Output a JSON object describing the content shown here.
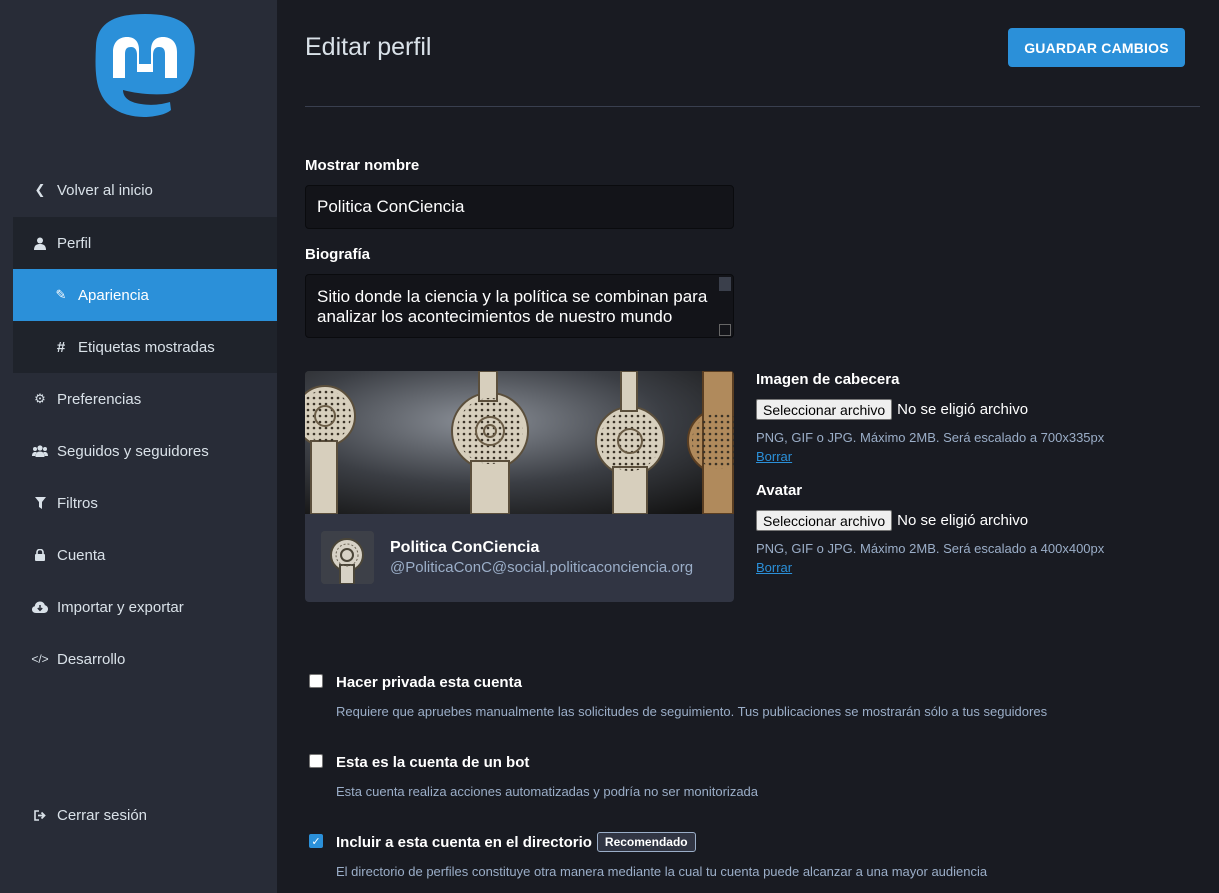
{
  "sidebar": {
    "back": "Volver al inicio",
    "items": [
      {
        "label": "Perfil",
        "icon": "user-icon"
      },
      {
        "label": "Apariencia",
        "icon": "pencil-icon"
      },
      {
        "label": "Etiquetas mostradas",
        "icon": "hashtag-icon"
      },
      {
        "label": "Preferencias",
        "icon": "gear-icon"
      },
      {
        "label": "Seguidos y seguidores",
        "icon": "users-icon"
      },
      {
        "label": "Filtros",
        "icon": "filter-icon"
      },
      {
        "label": "Cuenta",
        "icon": "lock-icon"
      },
      {
        "label": "Importar y exportar",
        "icon": "cloud-download-icon"
      },
      {
        "label": "Desarrollo",
        "icon": "code-icon"
      }
    ],
    "logout": "Cerrar sesión"
  },
  "header": {
    "title": "Editar perfil",
    "save_label": "GUARDAR CAMBIOS"
  },
  "form": {
    "display_name_label": "Mostrar nombre",
    "display_name_value": "Politica ConCiencia",
    "bio_label": "Biografía",
    "bio_value": "Sitio donde la ciencia y la política se combinan para analizar los acontecimientos de nuestro mundo"
  },
  "preview": {
    "name": "Politica ConCiencia",
    "handle": "@PoliticaConC@social.politicaconciencia.org"
  },
  "header_image": {
    "label": "Imagen de cabecera",
    "button": "Seleccionar archivo",
    "status": "No se eligió archivo",
    "hint": "PNG, GIF o JPG. Máximo 2MB. Será escalado a 700x335px",
    "delete": "Borrar"
  },
  "avatar_field": {
    "label": "Avatar",
    "button": "Seleccionar archivo",
    "status": "No se eligió archivo",
    "hint": "PNG, GIF o JPG. Máximo 2MB. Será escalado a 400x400px",
    "delete": "Borrar"
  },
  "options": [
    {
      "label": "Hacer privada esta cuenta",
      "hint": "Requiere que apruebes manualmente las solicitudes de seguimiento. Tus publicaciones se mostrarán sólo a tus seguidores",
      "checked": false
    },
    {
      "label": "Esta es la cuenta de un bot",
      "hint": "Esta cuenta realiza acciones automatizadas y podría no ser monitorizada",
      "checked": false
    },
    {
      "label": "Incluir a esta cuenta en el directorio",
      "badge": "Recomendado",
      "hint": "El directorio de perfiles constituye otra manera mediante la cual tu cuenta puede alcanzar a una mayor audiencia",
      "checked": true
    }
  ],
  "colors": {
    "accent": "#2b90d9",
    "sidebar": "#282c37",
    "background": "#191b22"
  }
}
